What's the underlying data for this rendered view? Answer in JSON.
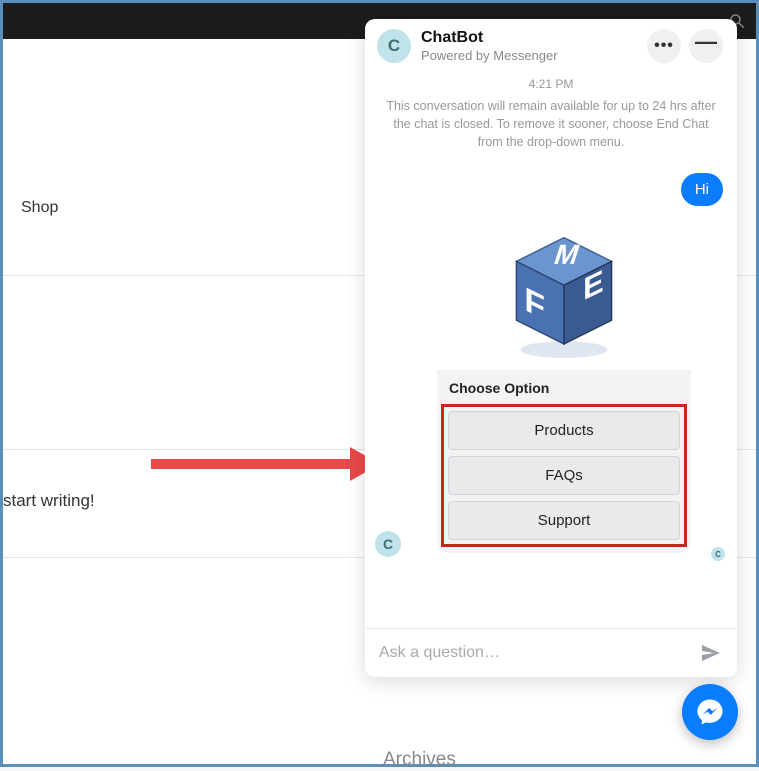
{
  "page": {
    "shop_label": "Shop",
    "start_writing": "start writing!",
    "archives_label": "Archives"
  },
  "chat": {
    "title": "ChatBot",
    "subtitle": "Powered by Messenger",
    "avatar_letter": "C",
    "timestamp": "4:21 PM",
    "disclaimer": "This conversation will remain available for up to 24 hrs after the chat is closed. To remove it sooner, choose End Chat from the drop-down menu.",
    "user_message": "Hi",
    "card": {
      "label": "Choose Option",
      "options": [
        "Products",
        "FAQs",
        "Support"
      ],
      "cube_letters": {
        "top": "M",
        "left": "F",
        "right": "E"
      }
    },
    "input_placeholder": "Ask a question…"
  }
}
